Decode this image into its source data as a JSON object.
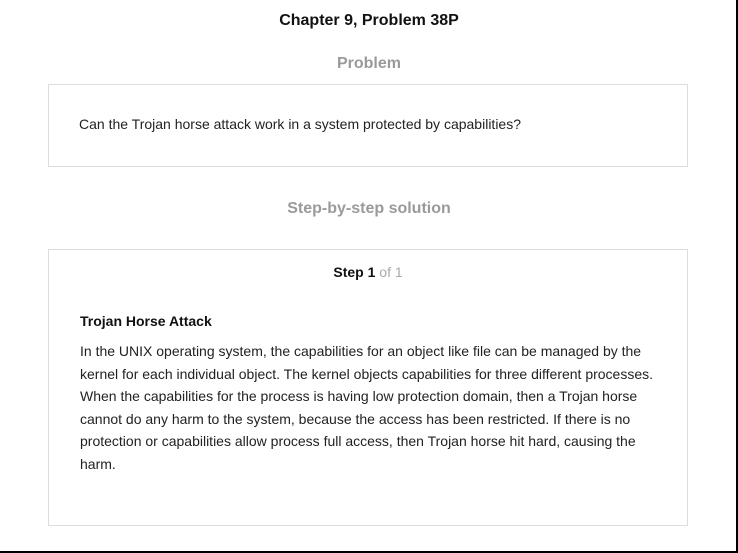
{
  "header": {
    "title": "Chapter 9, Problem 38P"
  },
  "problem": {
    "heading": "Problem",
    "text": "Can the Trojan horse attack work in a system protected by capabilities?"
  },
  "solution": {
    "heading": "Step-by-step solution",
    "step": {
      "word": "Step",
      "number": "1",
      "of_text": "of 1",
      "title": "Trojan Horse Attack",
      "body": "In the UNIX operating system, the capabilities for an object like file can be managed by the kernel for each individual object. The kernel objects capabilities for three different processes. When the capabilities for the process is having low protection domain, then a Trojan horse cannot do any harm to the system, because the access has been restricted. If there is no protection or capabilities allow process full access, then Trojan horse hit hard, causing the harm."
    }
  }
}
